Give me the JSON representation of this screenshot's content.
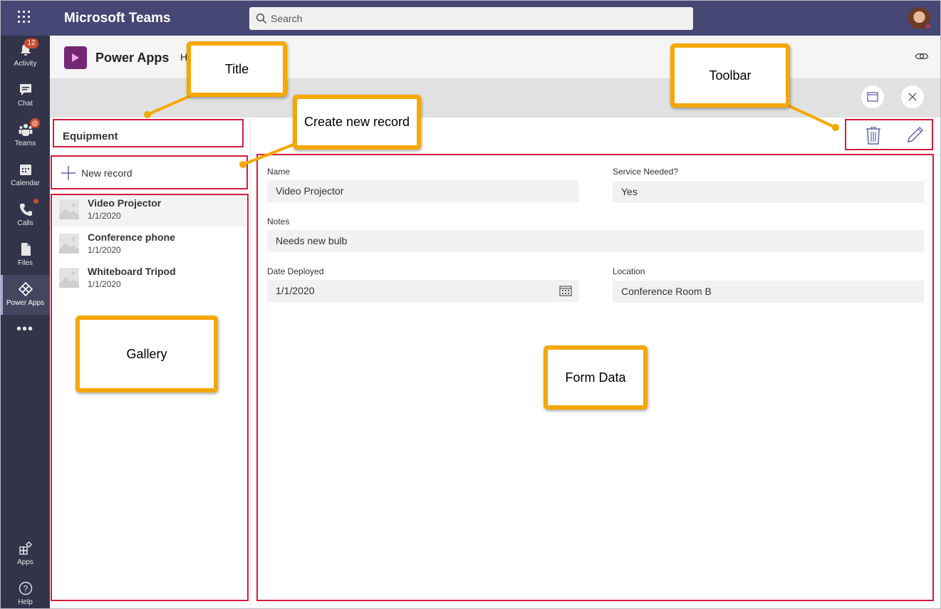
{
  "topbar": {
    "app_title": "Microsoft Teams",
    "search_placeholder": "Search"
  },
  "rail": {
    "items": [
      {
        "label": "Activity",
        "icon": "bell-icon",
        "badge": "12"
      },
      {
        "label": "Chat",
        "icon": "chat-icon"
      },
      {
        "label": "Teams",
        "icon": "teams-icon",
        "badge": "@"
      },
      {
        "label": "Calendar",
        "icon": "calendar-icon"
      },
      {
        "label": "Calls",
        "icon": "phone-icon"
      },
      {
        "label": "Files",
        "icon": "file-icon"
      },
      {
        "label": "Power Apps",
        "icon": "power-apps-icon"
      },
      {
        "label": "Apps",
        "icon": "apps-icon"
      },
      {
        "label": "Help",
        "icon": "help-icon"
      }
    ],
    "more": "•••"
  },
  "app_header": {
    "title": "Power Apps",
    "tab_fragment": "H"
  },
  "screen": {
    "title": "Equipment",
    "new_record_label": "New record"
  },
  "gallery": {
    "items": [
      {
        "title": "Video Projector",
        "date": "1/1/2020"
      },
      {
        "title": "Conference phone",
        "date": "1/1/2020"
      },
      {
        "title": "Whiteboard Tripod",
        "date": "1/1/2020"
      }
    ]
  },
  "form": {
    "name_label": "Name",
    "name_value": "Video Projector",
    "service_label": "Service Needed?",
    "service_value": "Yes",
    "notes_label": "Notes",
    "notes_value": "Needs new bulb",
    "date_label": "Date Deployed",
    "date_value": "1/1/2020",
    "location_label": "Location",
    "location_value": "Conference Room B"
  },
  "callouts": {
    "title": "Title",
    "create_new_record": "Create new record",
    "toolbar": "Toolbar",
    "gallery": "Gallery",
    "form_data": "Form Data"
  },
  "colors": {
    "teams_bar": "#464775",
    "rail": "#33344a",
    "power_apps_brand": "#742774",
    "annotation_border": "#d21d3c",
    "callout_border": "#f5a800",
    "toolbar_icon": "#6264a7"
  }
}
